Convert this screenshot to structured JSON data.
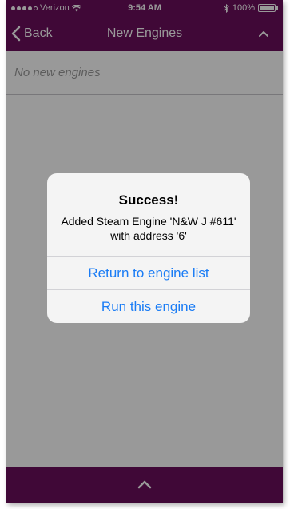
{
  "status_bar": {
    "carrier": "Verizon",
    "time": "9:54 AM",
    "battery": "100%"
  },
  "nav": {
    "back_label": "Back",
    "title": "New Engines"
  },
  "content": {
    "empty_message": "No new engines"
  },
  "alert": {
    "title": "Success!",
    "message": "Added Steam Engine 'N&W J #611' with address '6'",
    "buttons": [
      {
        "label": "Return to engine list"
      },
      {
        "label": "Run this engine"
      }
    ]
  },
  "colors": {
    "brand": "#6b0e5c",
    "link": "#1a7cf5",
    "placeholder": "#9a9a9a"
  }
}
